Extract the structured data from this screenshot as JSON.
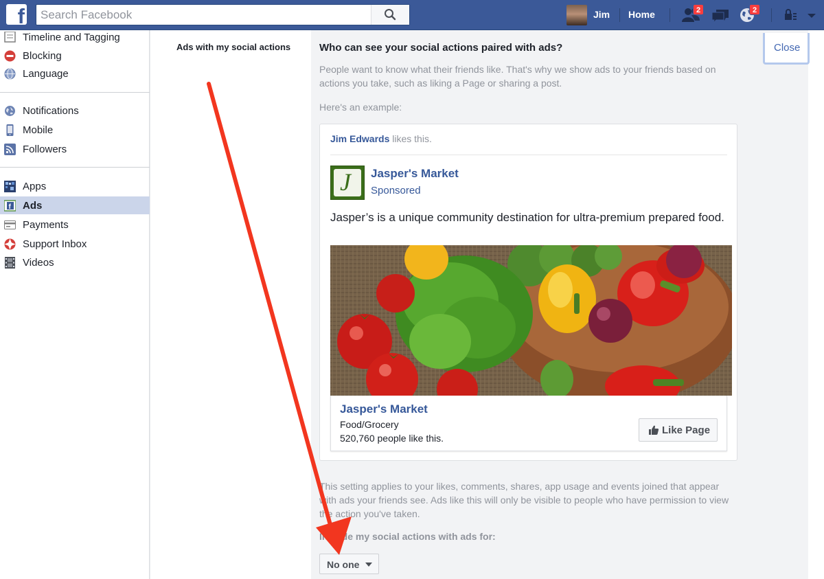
{
  "topbar": {
    "logo_letter": "f",
    "search_placeholder": "Search Facebook",
    "user_name": "Jim",
    "home_label": "Home",
    "friend_requests_badge": "2",
    "notifications_badge": "2"
  },
  "sidebar": {
    "items": [
      {
        "label": "Timeline and Tagging",
        "icon": "timeline-icon"
      },
      {
        "label": "Blocking",
        "icon": "blocking-icon"
      },
      {
        "label": "Language",
        "icon": "language-icon"
      },
      {
        "label": "Notifications",
        "icon": "globe-icon"
      },
      {
        "label": "Mobile",
        "icon": "mobile-icon"
      },
      {
        "label": "Followers",
        "icon": "rss-icon"
      },
      {
        "label": "Apps",
        "icon": "apps-icon"
      },
      {
        "label": "Ads",
        "icon": "ads-icon",
        "active": true
      },
      {
        "label": "Payments",
        "icon": "credit-card-icon"
      },
      {
        "label": "Support Inbox",
        "icon": "lifebuoy-icon"
      },
      {
        "label": "Videos",
        "icon": "film-icon"
      }
    ]
  },
  "setting": {
    "label": "Ads with my social actions",
    "question": "Who can see your social actions paired with ads?",
    "description": "People want to know what their friends like. That's why we show ads to your friends based on actions you take, such as liking a Page or sharing a post.",
    "example_label": "Here's an example:",
    "close_label": "Close",
    "applies_text": "This setting applies to your likes, comments, shares, app usage and events joined that appear with ads your friends see. Ads like this will only be visible to people who have permission to view the action you've taken.",
    "include_label": "Include my social actions with ads for:",
    "dropdown_value": "No one"
  },
  "example_ad": {
    "social_name": "Jim Edwards",
    "social_suffix": " likes this.",
    "logo_letter": "J",
    "page_name": "Jasper's Market",
    "sponsored": "Sponsored",
    "ad_text": "Jasper’s is a unique community destination for ultra-premium prepared food.",
    "footer_name": "Jasper's Market",
    "footer_category": "Food/Grocery",
    "footer_likes": "520,760 people like this.",
    "like_button": "Like Page"
  },
  "colors": {
    "brand_blue": "#3b5998",
    "link_blue": "#365899",
    "annotation_arrow": "#f2361f",
    "badge_red": "#fa3e3e"
  }
}
